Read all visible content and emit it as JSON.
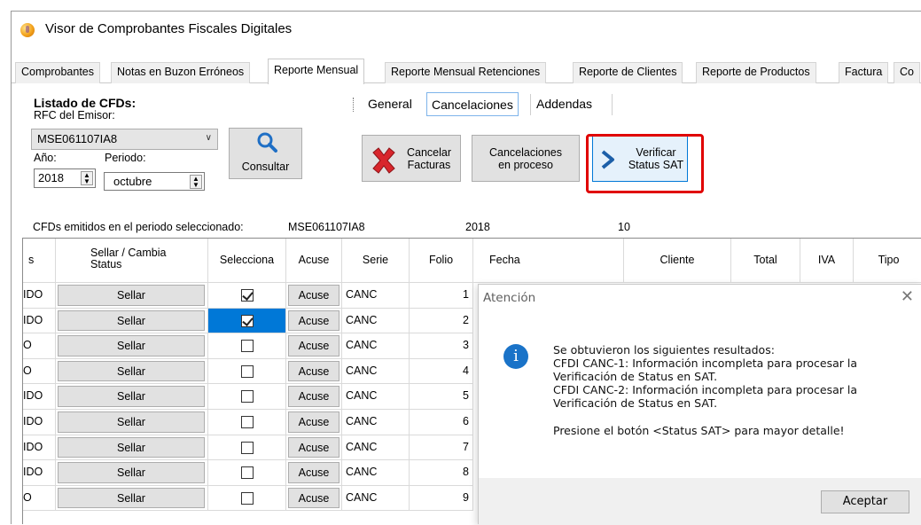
{
  "window": {
    "title": "Visor de Comprobantes Fiscales Digitales"
  },
  "tabs": [
    "Comprobantes",
    "Notas en Buzon Erróneos",
    "Reporte Mensual",
    "Reporte Mensual Retenciones",
    "Reporte de Clientes",
    "Reporte de Productos",
    "Factura",
    "Co"
  ],
  "filters": {
    "title": "Listado de CFDs:",
    "rfc_label": "RFC del Emisor:",
    "rfc_value": "MSE061107IA8",
    "anio_label": "Año:",
    "anio_value": "2018",
    "periodo_label": "Periodo:",
    "periodo_value": "octubre",
    "consultar": "Consultar"
  },
  "subtabs": [
    "General",
    "Cancelaciones",
    "Addendas"
  ],
  "actions": {
    "cancelar_l1": "Cancelar",
    "cancelar_l2": "Facturas",
    "proceso_l1": "Cancelaciones",
    "proceso_l2": "en proceso",
    "verificar_l1": "Verificar",
    "verificar_l2": "Status SAT"
  },
  "info": {
    "label": "CFDs emitidos en el periodo seleccionado:",
    "rfc": "MSE061107IA8",
    "year": "2018",
    "month": "10"
  },
  "grid": {
    "headers": {
      "status": "s",
      "sellar_l1": "Sellar / Cambia",
      "sellar_l2": "Status",
      "selecciona": "Selecciona",
      "acuse": "Acuse",
      "serie": "Serie",
      "folio": "Folio",
      "fecha": "Fecha",
      "cliente": "Cliente",
      "total": "Total",
      "iva": "IVA",
      "tipo": "Tipo"
    },
    "rows": [
      {
        "status": "IDO",
        "sellar": "Sellar",
        "checked": true,
        "acuse": "Acuse",
        "serie": "CANC",
        "folio": "1"
      },
      {
        "status": "IDO",
        "sellar": "Sellar",
        "checked": true,
        "acuse": "Acuse",
        "serie": "CANC",
        "folio": "2"
      },
      {
        "status": "O",
        "sellar": "Sellar",
        "checked": false,
        "acuse": "Acuse",
        "serie": "CANC",
        "folio": "3"
      },
      {
        "status": "O",
        "sellar": "Sellar",
        "checked": false,
        "acuse": "Acuse",
        "serie": "CANC",
        "folio": "4"
      },
      {
        "status": "IDO",
        "sellar": "Sellar",
        "checked": false,
        "acuse": "Acuse",
        "serie": "CANC",
        "folio": "5"
      },
      {
        "status": "IDO",
        "sellar": "Sellar",
        "checked": false,
        "acuse": "Acuse",
        "serie": "CANC",
        "folio": "6"
      },
      {
        "status": "IDO",
        "sellar": "Sellar",
        "checked": false,
        "acuse": "Acuse",
        "serie": "CANC",
        "folio": "7"
      },
      {
        "status": "IDO",
        "sellar": "Sellar",
        "checked": false,
        "acuse": "Acuse",
        "serie": "CANC",
        "folio": "8"
      },
      {
        "status": "O",
        "sellar": "Sellar",
        "checked": false,
        "acuse": "Acuse",
        "serie": "CANC",
        "folio": "9"
      }
    ]
  },
  "dialog": {
    "title": "Atención",
    "lines": [
      "Se obtuvieron los siguientes resultados:",
      "CFDI CANC-1: Información incompleta para procesar la",
      "Verificación de Status en SAT.",
      "CFDI CANC-2: Información incompleta para procesar la",
      "Verificación de Status en SAT.",
      "Presione el botón <Status SAT> para mayor detalle!"
    ],
    "accept": "Aceptar"
  }
}
